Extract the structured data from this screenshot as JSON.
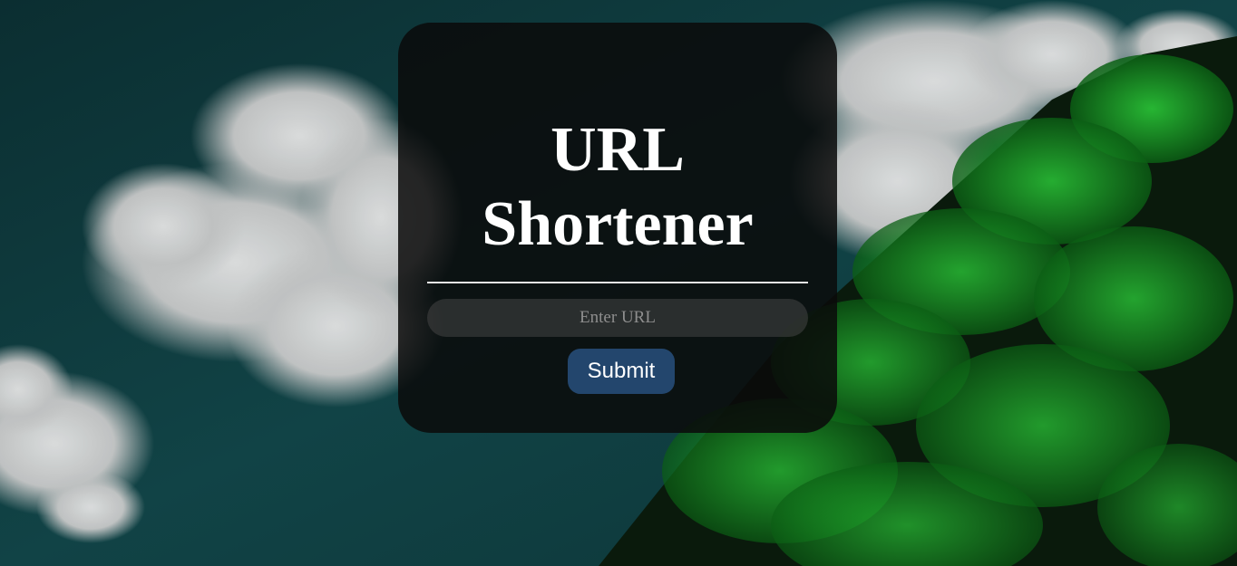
{
  "page": {
    "title_line1": "URL",
    "title_line2": "Shortener"
  },
  "form": {
    "url_placeholder": "Enter URL",
    "url_value": "",
    "submit_label": "Submit"
  },
  "colors": {
    "accent_button": "#23466d",
    "card_background": "#0a0a0a",
    "sky": "#0f3a3c",
    "foliage": "#1fbf2a"
  }
}
